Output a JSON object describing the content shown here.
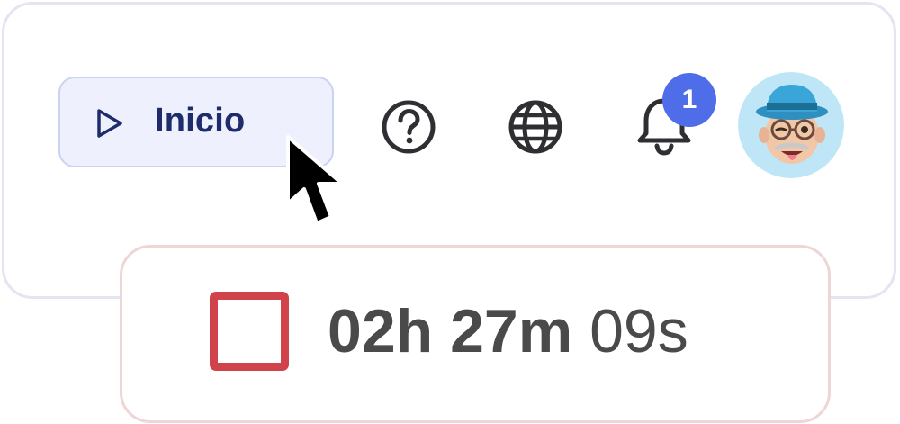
{
  "toolbar": {
    "start_button": {
      "label": "Inicio",
      "icon": "play-icon"
    },
    "help": {
      "icon": "help-circle-icon"
    },
    "language": {
      "icon": "globe-icon"
    },
    "notifications": {
      "icon": "bell-icon",
      "count": "1"
    },
    "avatar": {
      "icon": "memoji-avatar"
    }
  },
  "timer": {
    "hours": "02h",
    "minutes": "27m",
    "seconds": "09s",
    "stop_icon": "stop-square-icon"
  },
  "colors": {
    "accent": "#4f6de8",
    "start_bg": "#eef1fd",
    "start_text": "#1f2c6b",
    "stop": "#d0434a",
    "timer_text": "#4a4a4a"
  }
}
